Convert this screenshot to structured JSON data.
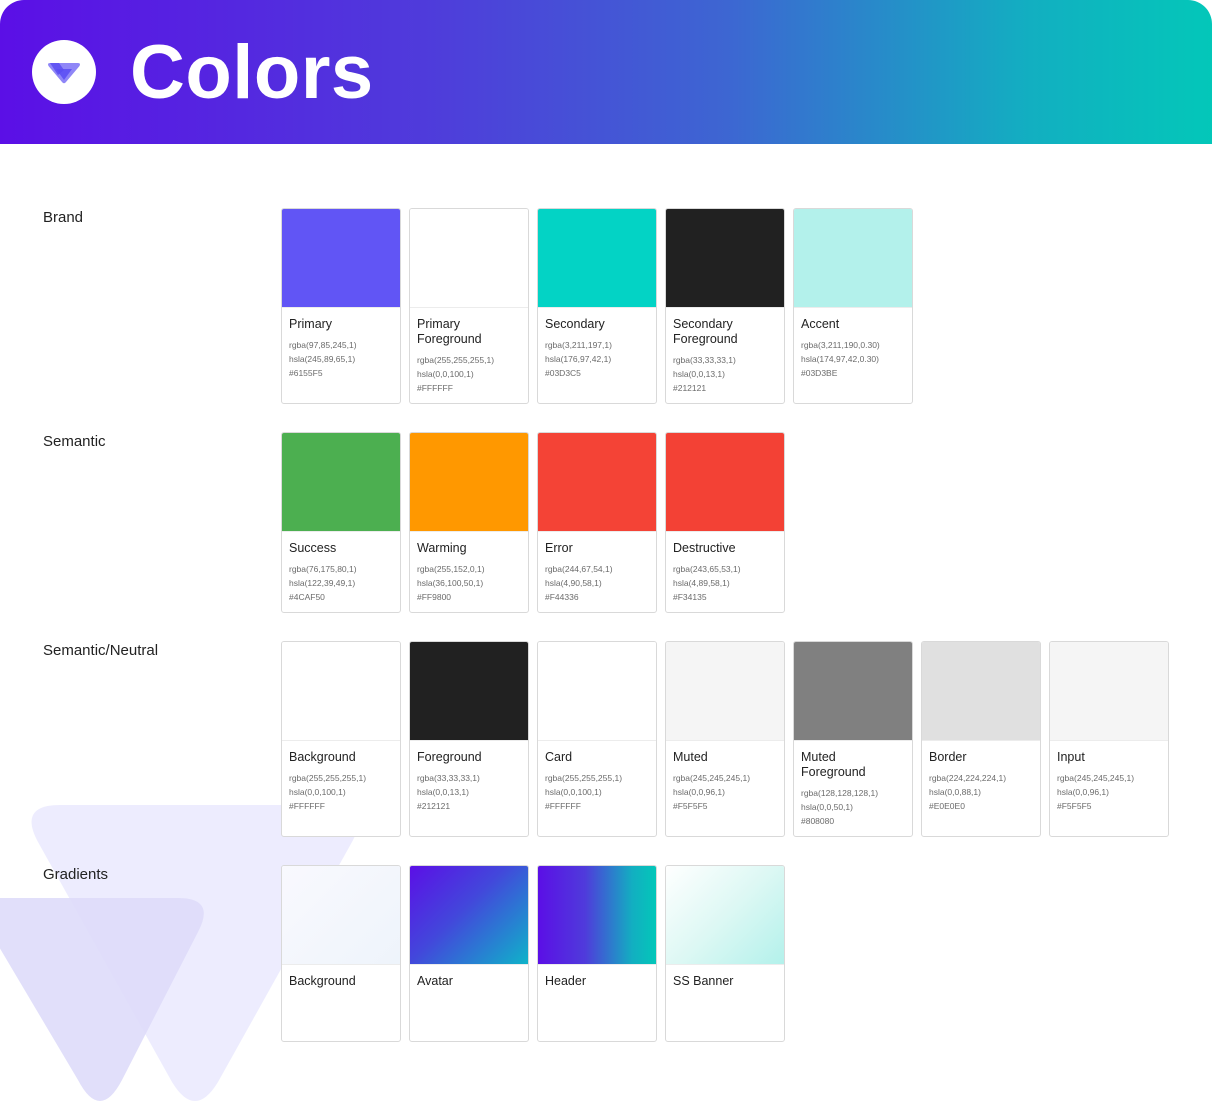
{
  "header": {
    "title": "Colors",
    "logo_icon": "brand-logo-icon"
  },
  "sections": {
    "brand": {
      "label": "Brand",
      "cards": [
        {
          "name": "Primary",
          "rgba": "rgba(97,85,245,1)",
          "hsla": "hsla(245,89,65,1)",
          "hex": "#6155F5",
          "color": "#6155F5"
        },
        {
          "name": "Primary\nForeground",
          "rgba": "rgba(255,255,255,1)",
          "hsla": "hsla(0,0,100,1)",
          "hex": "#FFFFFF",
          "color": "#FFFFFF"
        },
        {
          "name": "Secondary",
          "rgba": "rgba(3,211,197,1)",
          "hsla": "hsla(176,97,42,1)",
          "hex": "#03D3C5",
          "color": "#03D3C5"
        },
        {
          "name": "Secondary\nForeground",
          "rgba": "rgba(33,33,33,1)",
          "hsla": "hsla(0,0,13,1)",
          "hex": "#212121",
          "color": "#212121"
        },
        {
          "name": "Accent",
          "rgba": "rgba(3,211,190,0.30)",
          "hsla": "hsla(174,97,42,0.30)",
          "hex": "#03D3BE",
          "color": "#B3F1EB"
        }
      ]
    },
    "semantic": {
      "label": "Semantic",
      "cards": [
        {
          "name": "Success",
          "rgba": "rgba(76,175,80,1)",
          "hsla": "hsla(122,39,49,1)",
          "hex": "#4CAF50",
          "color": "#4CAF50"
        },
        {
          "name": "Warming",
          "rgba": "rgba(255,152,0,1)",
          "hsla": "hsla(36,100,50,1)",
          "hex": "#FF9800",
          "color": "#FF9800"
        },
        {
          "name": "Error",
          "rgba": "rgba(244,67,54,1)",
          "hsla": "hsla(4,90,58,1)",
          "hex": "#F44336",
          "color": "#F44336"
        },
        {
          "name": "Destructive",
          "rgba": "rgba(243,65,53,1)",
          "hsla": "hsla(4,89,58,1)",
          "hex": "#F34135",
          "color": "#F34135"
        }
      ]
    },
    "neutral": {
      "label": "Semantic/Neutral",
      "cards": [
        {
          "name": "Background",
          "rgba": "rgba(255,255,255,1)",
          "hsla": "hsla(0,0,100,1)",
          "hex": "#FFFFFF",
          "color": "#FFFFFF"
        },
        {
          "name": "Foreground",
          "rgba": "rgba(33,33,33,1)",
          "hsla": "hsla(0,0,13,1)",
          "hex": "#212121",
          "color": "#212121"
        },
        {
          "name": "Card",
          "rgba": "rgba(255,255,255,1)",
          "hsla": "hsla(0,0,100,1)",
          "hex": "#FFFFFF",
          "color": "#FFFFFF"
        },
        {
          "name": "Muted",
          "rgba": "rgba(245,245,245,1)",
          "hsla": "hsla(0,0,96,1)",
          "hex": "#F5F5F5",
          "color": "#F5F5F5"
        },
        {
          "name": "Muted\nForeground",
          "rgba": "rgba(128,128,128,1)",
          "hsla": "hsla(0,0,50,1)",
          "hex": "#808080",
          "color": "#808080"
        },
        {
          "name": "Border",
          "rgba": "rgba(224,224,224,1)",
          "hsla": "hsla(0,0,88,1)",
          "hex": "#E0E0E0",
          "color": "#E0E0E0"
        },
        {
          "name": "Input",
          "rgba": "rgba(245,245,245,1)",
          "hsla": "hsla(0,0,96,1)",
          "hex": "#F5F5F5",
          "color": "#F5F5F5"
        }
      ]
    },
    "gradients": {
      "label": "Gradients",
      "cards": [
        {
          "name": "Background",
          "gradient": "linear-gradient(135deg, #F9F9FE 0%, #EEF4FB 100%)"
        },
        {
          "name": "Avatar",
          "gradient": "linear-gradient(135deg, #5B0FE6 0%, #4248DB 45%, #0FB3C9 100%)"
        },
        {
          "name": "Header",
          "gradient": "linear-gradient(90deg, #5B0FE6 0%, #4F3BDB 40%, #12AFC1 80%, #03C7B9 100%)"
        },
        {
          "name": "SS Banner",
          "gradient": "linear-gradient(135deg, #FFFFFF 0%, #DDF8F4 50%, #B3F1EB 100%)"
        }
      ]
    }
  }
}
